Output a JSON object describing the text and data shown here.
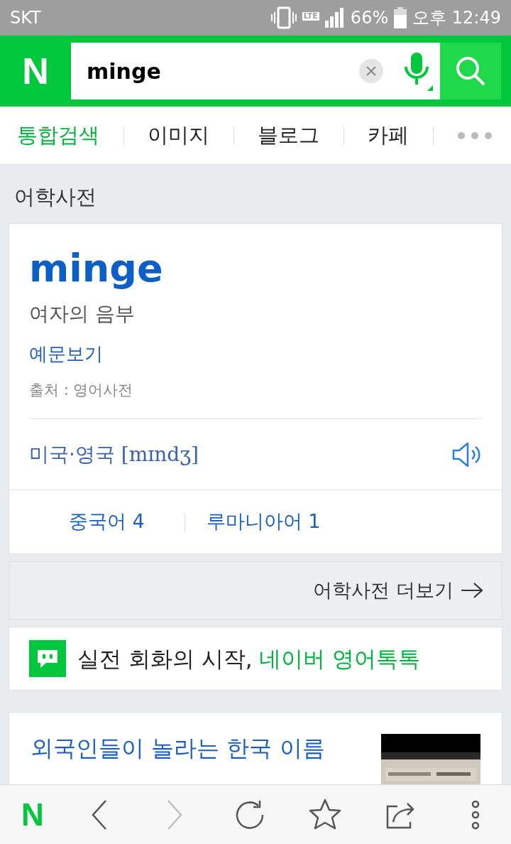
{
  "status_bar": {
    "carrier": "SKT",
    "network": "LTE",
    "battery": "66%",
    "time": "오후 12:49"
  },
  "header": {
    "logo": "N",
    "search_value": "minge"
  },
  "tabs": [
    {
      "label": "통합검색",
      "selected": true
    },
    {
      "label": "이미지",
      "selected": false
    },
    {
      "label": "블로그",
      "selected": false
    },
    {
      "label": "카페",
      "selected": false
    }
  ],
  "dictionary": {
    "section_title": "어학사전",
    "word": "minge",
    "meaning": "여자의 음부",
    "examples_link": "예문보기",
    "source": "출처 : 영어사전",
    "pronunciation_label": "미국·영국",
    "pronunciation": "[mɪndʒ]",
    "languages": [
      {
        "label": "중국어 4"
      },
      {
        "label": "루마니아어 1"
      }
    ],
    "more": "어학사전 더보기"
  },
  "promo": {
    "text": "실전 회화의 시작,",
    "link": "네이버 영어톡톡"
  },
  "article": {
    "title": "외국인들이 놀라는 한국 이름"
  },
  "bottom_nav": {
    "logo": "N",
    "items": [
      {
        "kind": "back",
        "disabled": false
      },
      {
        "kind": "forward",
        "disabled": true
      },
      {
        "kind": "reload",
        "disabled": false
      },
      {
        "kind": "bookmark",
        "disabled": false
      },
      {
        "kind": "share",
        "disabled": false
      },
      {
        "kind": "more",
        "disabled": false
      }
    ]
  }
}
